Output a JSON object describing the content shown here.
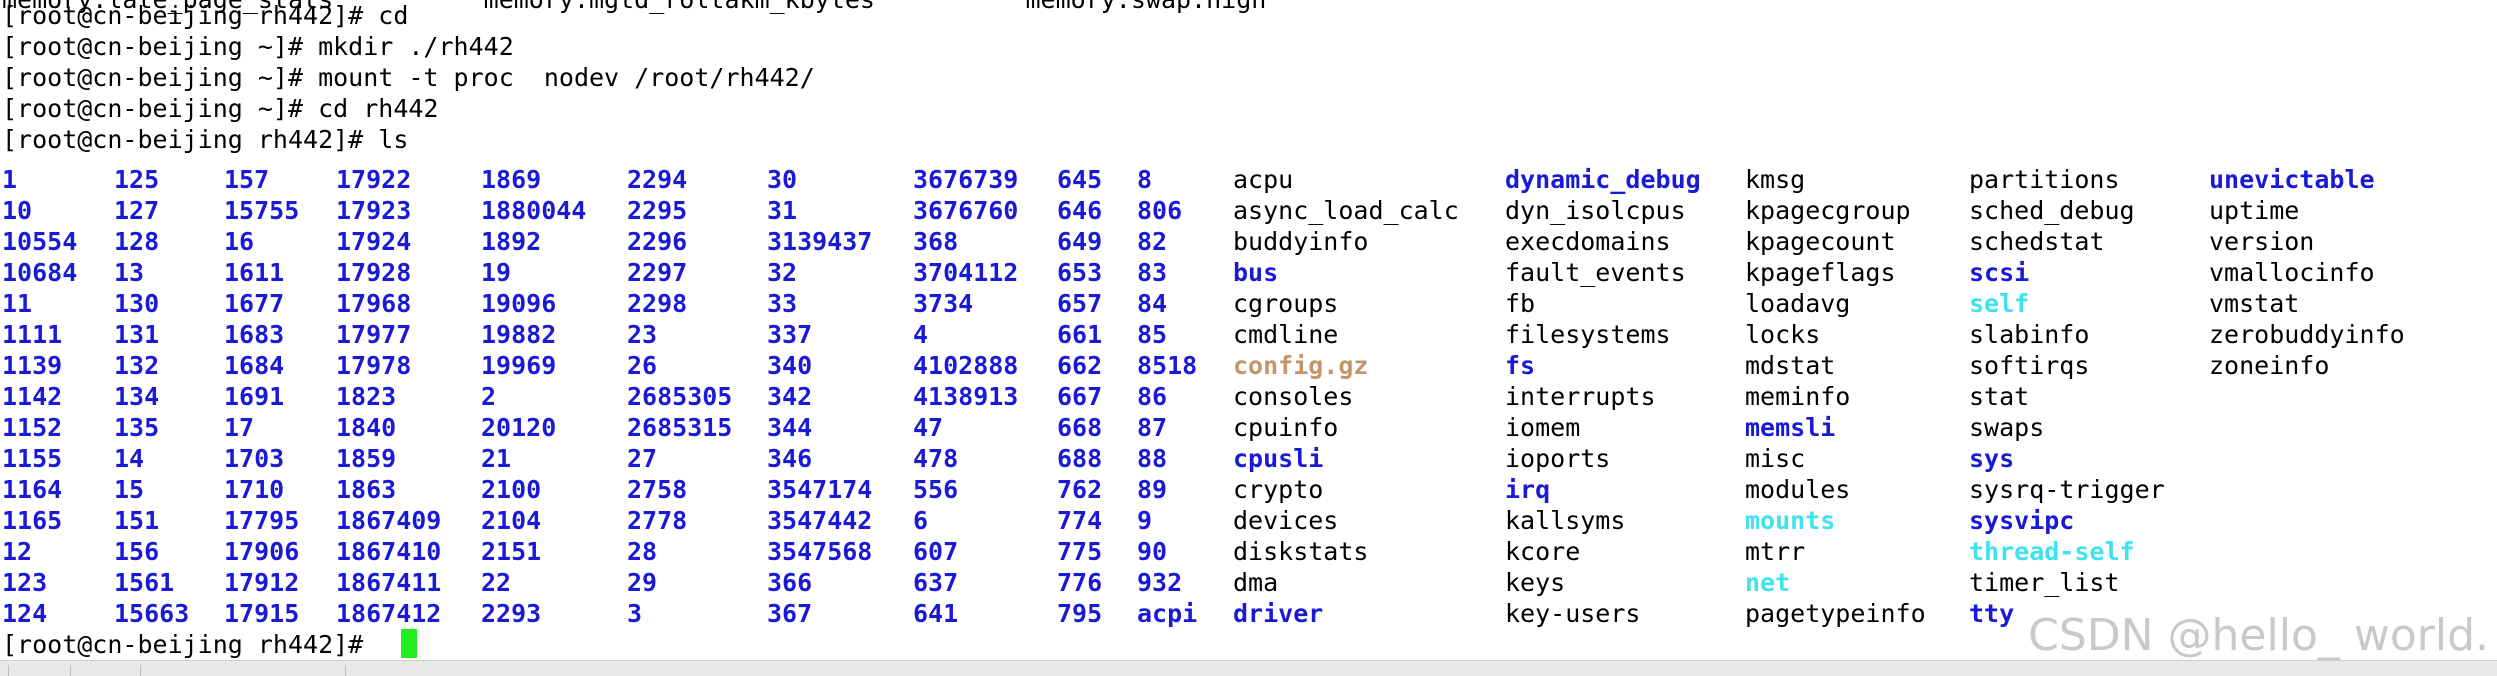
{
  "terminal": {
    "top_cut_line": "memory.late_page_stats          memory.mgtd_roltakm_kbytes          memory.swap.high",
    "lines": [
      "[root@cn-beijing rh442]# cd",
      "[root@cn-beijing ~]# mkdir ./rh442",
      "[root@cn-beijing ~]# mount -t proc  nodev /root/rh442/",
      "[root@cn-beijing ~]# cd rh442",
      "[root@cn-beijing rh442]# ls"
    ],
    "prompt": "[root@cn-beijing rh442]# "
  },
  "colors": {
    "directory": "#1a1ad6",
    "regular_file": "#000000",
    "symlink": "#3ee3ee",
    "archive": "#c4956a",
    "cursor": "#22ee22",
    "background": "#ffffff"
  },
  "ls_columns": [
    {
      "items": [
        {
          "name": "1",
          "type": "dir"
        },
        {
          "name": "10",
          "type": "dir"
        },
        {
          "name": "10554",
          "type": "dir"
        },
        {
          "name": "10684",
          "type": "dir"
        },
        {
          "name": "11",
          "type": "dir"
        },
        {
          "name": "1111",
          "type": "dir"
        },
        {
          "name": "1139",
          "type": "dir"
        },
        {
          "name": "1142",
          "type": "dir"
        },
        {
          "name": "1152",
          "type": "dir"
        },
        {
          "name": "1155",
          "type": "dir"
        },
        {
          "name": "1164",
          "type": "dir"
        },
        {
          "name": "1165",
          "type": "dir"
        },
        {
          "name": "12",
          "type": "dir"
        },
        {
          "name": "123",
          "type": "dir"
        },
        {
          "name": "124",
          "type": "dir"
        }
      ]
    },
    {
      "items": [
        {
          "name": "125",
          "type": "dir"
        },
        {
          "name": "127",
          "type": "dir"
        },
        {
          "name": "128",
          "type": "dir"
        },
        {
          "name": "13",
          "type": "dir"
        },
        {
          "name": "130",
          "type": "dir"
        },
        {
          "name": "131",
          "type": "dir"
        },
        {
          "name": "132",
          "type": "dir"
        },
        {
          "name": "134",
          "type": "dir"
        },
        {
          "name": "135",
          "type": "dir"
        },
        {
          "name": "14",
          "type": "dir"
        },
        {
          "name": "15",
          "type": "dir"
        },
        {
          "name": "151",
          "type": "dir"
        },
        {
          "name": "156",
          "type": "dir"
        },
        {
          "name": "1561",
          "type": "dir"
        },
        {
          "name": "15663",
          "type": "dir"
        }
      ]
    },
    {
      "items": [
        {
          "name": "157",
          "type": "dir"
        },
        {
          "name": "15755",
          "type": "dir"
        },
        {
          "name": "16",
          "type": "dir"
        },
        {
          "name": "1611",
          "type": "dir"
        },
        {
          "name": "1677",
          "type": "dir"
        },
        {
          "name": "1683",
          "type": "dir"
        },
        {
          "name": "1684",
          "type": "dir"
        },
        {
          "name": "1691",
          "type": "dir"
        },
        {
          "name": "17",
          "type": "dir"
        },
        {
          "name": "1703",
          "type": "dir"
        },
        {
          "name": "1710",
          "type": "dir"
        },
        {
          "name": "17795",
          "type": "dir"
        },
        {
          "name": "17906",
          "type": "dir"
        },
        {
          "name": "17912",
          "type": "dir"
        },
        {
          "name": "17915",
          "type": "dir"
        }
      ]
    },
    {
      "items": [
        {
          "name": "17922",
          "type": "dir"
        },
        {
          "name": "17923",
          "type": "dir"
        },
        {
          "name": "17924",
          "type": "dir"
        },
        {
          "name": "17928",
          "type": "dir"
        },
        {
          "name": "17968",
          "type": "dir"
        },
        {
          "name": "17977",
          "type": "dir"
        },
        {
          "name": "17978",
          "type": "dir"
        },
        {
          "name": "1823",
          "type": "dir"
        },
        {
          "name": "1840",
          "type": "dir"
        },
        {
          "name": "1859",
          "type": "dir"
        },
        {
          "name": "1863",
          "type": "dir"
        },
        {
          "name": "1867409",
          "type": "dir"
        },
        {
          "name": "1867410",
          "type": "dir"
        },
        {
          "name": "1867411",
          "type": "dir"
        },
        {
          "name": "1867412",
          "type": "dir"
        }
      ]
    },
    {
      "items": [
        {
          "name": "1869",
          "type": "dir"
        },
        {
          "name": "1880044",
          "type": "dir"
        },
        {
          "name": "1892",
          "type": "dir"
        },
        {
          "name": "19",
          "type": "dir"
        },
        {
          "name": "19096",
          "type": "dir"
        },
        {
          "name": "19882",
          "type": "dir"
        },
        {
          "name": "19969",
          "type": "dir"
        },
        {
          "name": "2",
          "type": "dir"
        },
        {
          "name": "20120",
          "type": "dir"
        },
        {
          "name": "21",
          "type": "dir"
        },
        {
          "name": "2100",
          "type": "dir"
        },
        {
          "name": "2104",
          "type": "dir"
        },
        {
          "name": "2151",
          "type": "dir"
        },
        {
          "name": "22",
          "type": "dir"
        },
        {
          "name": "2293",
          "type": "dir"
        }
      ]
    },
    {
      "items": [
        {
          "name": "2294",
          "type": "dir"
        },
        {
          "name": "2295",
          "type": "dir"
        },
        {
          "name": "2296",
          "type": "dir"
        },
        {
          "name": "2297",
          "type": "dir"
        },
        {
          "name": "2298",
          "type": "dir"
        },
        {
          "name": "23",
          "type": "dir"
        },
        {
          "name": "26",
          "type": "dir"
        },
        {
          "name": "2685305",
          "type": "dir"
        },
        {
          "name": "2685315",
          "type": "dir"
        },
        {
          "name": "27",
          "type": "dir"
        },
        {
          "name": "2758",
          "type": "dir"
        },
        {
          "name": "2778",
          "type": "dir"
        },
        {
          "name": "28",
          "type": "dir"
        },
        {
          "name": "29",
          "type": "dir"
        },
        {
          "name": "3",
          "type": "dir"
        }
      ]
    },
    {
      "items": [
        {
          "name": "30",
          "type": "dir"
        },
        {
          "name": "31",
          "type": "dir"
        },
        {
          "name": "3139437",
          "type": "dir"
        },
        {
          "name": "32",
          "type": "dir"
        },
        {
          "name": "33",
          "type": "dir"
        },
        {
          "name": "337",
          "type": "dir"
        },
        {
          "name": "340",
          "type": "dir"
        },
        {
          "name": "342",
          "type": "dir"
        },
        {
          "name": "344",
          "type": "dir"
        },
        {
          "name": "346",
          "type": "dir"
        },
        {
          "name": "3547174",
          "type": "dir"
        },
        {
          "name": "3547442",
          "type": "dir"
        },
        {
          "name": "3547568",
          "type": "dir"
        },
        {
          "name": "366",
          "type": "dir"
        },
        {
          "name": "367",
          "type": "dir"
        }
      ]
    },
    {
      "items": [
        {
          "name": "3676739",
          "type": "dir"
        },
        {
          "name": "3676760",
          "type": "dir"
        },
        {
          "name": "368",
          "type": "dir"
        },
        {
          "name": "3704112",
          "type": "dir"
        },
        {
          "name": "3734",
          "type": "dir"
        },
        {
          "name": "4",
          "type": "dir"
        },
        {
          "name": "4102888",
          "type": "dir"
        },
        {
          "name": "4138913",
          "type": "dir"
        },
        {
          "name": "47",
          "type": "dir"
        },
        {
          "name": "478",
          "type": "dir"
        },
        {
          "name": "556",
          "type": "dir"
        },
        {
          "name": "6",
          "type": "dir"
        },
        {
          "name": "607",
          "type": "dir"
        },
        {
          "name": "637",
          "type": "dir"
        },
        {
          "name": "641",
          "type": "dir"
        }
      ]
    },
    {
      "items": [
        {
          "name": "645",
          "type": "dir"
        },
        {
          "name": "646",
          "type": "dir"
        },
        {
          "name": "649",
          "type": "dir"
        },
        {
          "name": "653",
          "type": "dir"
        },
        {
          "name": "657",
          "type": "dir"
        },
        {
          "name": "661",
          "type": "dir"
        },
        {
          "name": "662",
          "type": "dir"
        },
        {
          "name": "667",
          "type": "dir"
        },
        {
          "name": "668",
          "type": "dir"
        },
        {
          "name": "688",
          "type": "dir"
        },
        {
          "name": "762",
          "type": "dir"
        },
        {
          "name": "774",
          "type": "dir"
        },
        {
          "name": "775",
          "type": "dir"
        },
        {
          "name": "776",
          "type": "dir"
        },
        {
          "name": "795",
          "type": "dir"
        }
      ]
    },
    {
      "items": [
        {
          "name": "8",
          "type": "dir"
        },
        {
          "name": "806",
          "type": "dir"
        },
        {
          "name": "82",
          "type": "dir"
        },
        {
          "name": "83",
          "type": "dir"
        },
        {
          "name": "84",
          "type": "dir"
        },
        {
          "name": "85",
          "type": "dir"
        },
        {
          "name": "8518",
          "type": "dir"
        },
        {
          "name": "86",
          "type": "dir"
        },
        {
          "name": "87",
          "type": "dir"
        },
        {
          "name": "88",
          "type": "dir"
        },
        {
          "name": "89",
          "type": "dir"
        },
        {
          "name": "9",
          "type": "dir"
        },
        {
          "name": "90",
          "type": "dir"
        },
        {
          "name": "932",
          "type": "dir"
        },
        {
          "name": "acpi",
          "type": "dir"
        }
      ]
    },
    {
      "items": [
        {
          "name": "acpu",
          "type": "file"
        },
        {
          "name": "async_load_calc",
          "type": "file"
        },
        {
          "name": "buddyinfo",
          "type": "file"
        },
        {
          "name": "bus",
          "type": "dir"
        },
        {
          "name": "cgroups",
          "type": "file"
        },
        {
          "name": "cmdline",
          "type": "file"
        },
        {
          "name": "config.gz",
          "type": "archive"
        },
        {
          "name": "consoles",
          "type": "file"
        },
        {
          "name": "cpuinfo",
          "type": "file"
        },
        {
          "name": "cpusli",
          "type": "dir"
        },
        {
          "name": "crypto",
          "type": "file"
        },
        {
          "name": "devices",
          "type": "file"
        },
        {
          "name": "diskstats",
          "type": "file"
        },
        {
          "name": "dma",
          "type": "file"
        },
        {
          "name": "driver",
          "type": "dir"
        }
      ]
    },
    {
      "items": [
        {
          "name": "dynamic_debug",
          "type": "dir"
        },
        {
          "name": "dyn_isolcpus",
          "type": "file"
        },
        {
          "name": "execdomains",
          "type": "file"
        },
        {
          "name": "fault_events",
          "type": "file"
        },
        {
          "name": "fb",
          "type": "file"
        },
        {
          "name": "filesystems",
          "type": "file"
        },
        {
          "name": "fs",
          "type": "dir"
        },
        {
          "name": "interrupts",
          "type": "file"
        },
        {
          "name": "iomem",
          "type": "file"
        },
        {
          "name": "ioports",
          "type": "file"
        },
        {
          "name": "irq",
          "type": "dir"
        },
        {
          "name": "kallsyms",
          "type": "file"
        },
        {
          "name": "kcore",
          "type": "file"
        },
        {
          "name": "keys",
          "type": "file"
        },
        {
          "name": "key-users",
          "type": "file"
        }
      ]
    },
    {
      "items": [
        {
          "name": "kmsg",
          "type": "file"
        },
        {
          "name": "kpagecgroup",
          "type": "file"
        },
        {
          "name": "kpagecount",
          "type": "file"
        },
        {
          "name": "kpageflags",
          "type": "file"
        },
        {
          "name": "loadavg",
          "type": "file"
        },
        {
          "name": "locks",
          "type": "file"
        },
        {
          "name": "mdstat",
          "type": "file"
        },
        {
          "name": "meminfo",
          "type": "file"
        },
        {
          "name": "memsli",
          "type": "dir"
        },
        {
          "name": "misc",
          "type": "file"
        },
        {
          "name": "modules",
          "type": "file"
        },
        {
          "name": "mounts",
          "type": "link"
        },
        {
          "name": "mtrr",
          "type": "file"
        },
        {
          "name": "net",
          "type": "link"
        },
        {
          "name": "pagetypeinfo",
          "type": "file"
        }
      ]
    },
    {
      "items": [
        {
          "name": "partitions",
          "type": "file"
        },
        {
          "name": "sched_debug",
          "type": "file"
        },
        {
          "name": "schedstat",
          "type": "file"
        },
        {
          "name": "scsi",
          "type": "dir"
        },
        {
          "name": "self",
          "type": "link"
        },
        {
          "name": "slabinfo",
          "type": "file"
        },
        {
          "name": "softirqs",
          "type": "file"
        },
        {
          "name": "stat",
          "type": "file"
        },
        {
          "name": "swaps",
          "type": "file"
        },
        {
          "name": "sys",
          "type": "dir"
        },
        {
          "name": "sysrq-trigger",
          "type": "file"
        },
        {
          "name": "sysvipc",
          "type": "dir"
        },
        {
          "name": "thread-self",
          "type": "link"
        },
        {
          "name": "timer_list",
          "type": "file"
        },
        {
          "name": "tty",
          "type": "dir"
        }
      ]
    },
    {
      "items": [
        {
          "name": "unevictable",
          "type": "dir"
        },
        {
          "name": "uptime",
          "type": "file"
        },
        {
          "name": "version",
          "type": "file"
        },
        {
          "name": "vmallocinfo",
          "type": "file"
        },
        {
          "name": "vmstat",
          "type": "file"
        },
        {
          "name": "zerobuddyinfo",
          "type": "file"
        },
        {
          "name": "zoneinfo",
          "type": "file"
        }
      ]
    }
  ],
  "watermark": "CSDN @hello_ world."
}
